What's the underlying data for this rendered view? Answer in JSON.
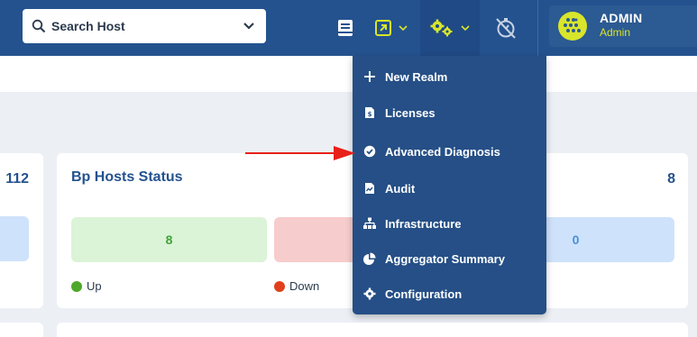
{
  "colors": {
    "topbar": "#24528f",
    "menu": "#254f86",
    "accent_yellow": "#d8e52b",
    "up": "#3fa33a",
    "down": "#e0401b",
    "arrow": "#e8201a"
  },
  "search": {
    "label": "Search Host",
    "icon": "search-icon"
  },
  "toolbar": {
    "icons": [
      "book-icon",
      "external-link-icon",
      "gears-icon",
      "stopwatch-slash-icon"
    ]
  },
  "user": {
    "name": "ADMIN",
    "role": "Admin"
  },
  "menu": {
    "items": [
      {
        "label": "New Realm",
        "icon": "plus-icon"
      },
      {
        "label": "Licenses",
        "icon": "license-file-icon"
      },
      {
        "label": "Advanced Diagnosis",
        "icon": "check-badge-icon"
      },
      {
        "label": "Audit",
        "icon": "audit-file-icon"
      },
      {
        "label": "Infrastructure",
        "icon": "sitemap-icon"
      },
      {
        "label": "Aggregator Summary",
        "icon": "pie-chart-icon"
      },
      {
        "label": "Configuration",
        "icon": "cog-icon"
      }
    ]
  },
  "left_card": {
    "count": "112"
  },
  "hosts_card": {
    "title": "Bp Hosts Status",
    "count": "8",
    "up_value": "8",
    "other_value": "0",
    "legend_up": "Up",
    "legend_down": "Down"
  }
}
